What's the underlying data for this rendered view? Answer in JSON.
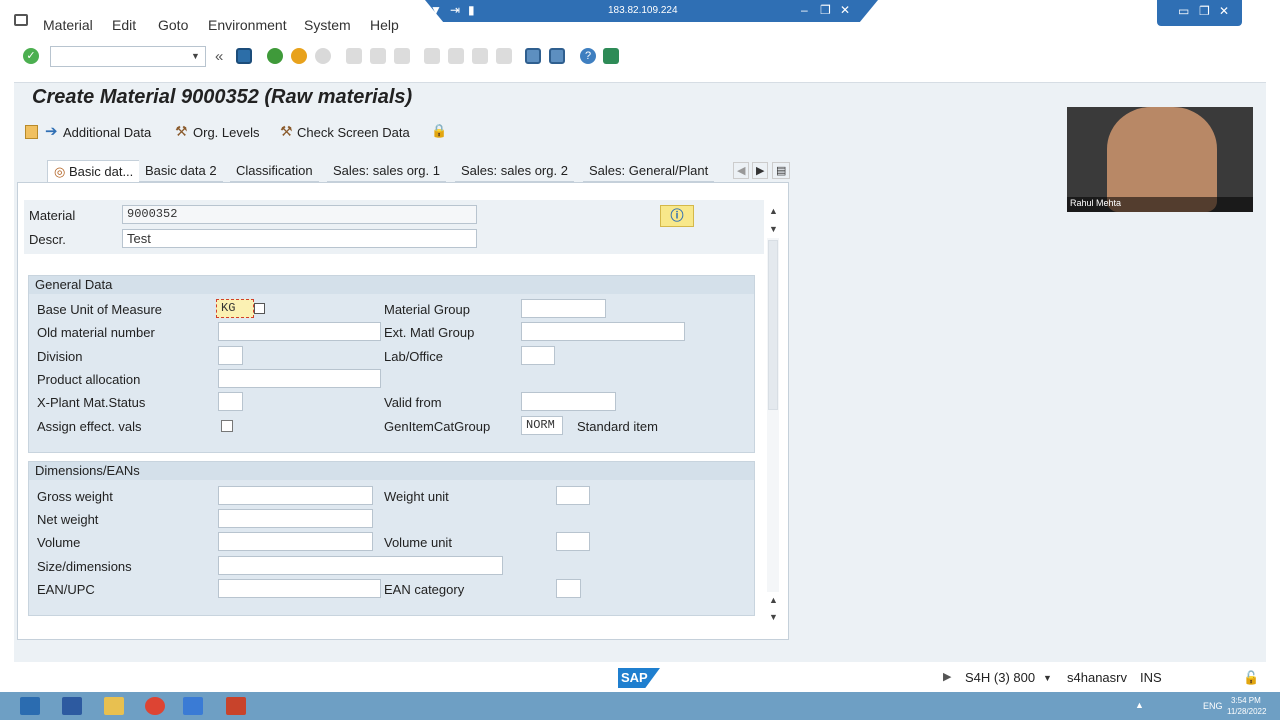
{
  "menubar": {
    "items": [
      "Material",
      "Edit",
      "Goto",
      "Environment",
      "System",
      "Help"
    ]
  },
  "titlebar": {
    "ip": "183.82.109.224"
  },
  "toolbar": {
    "command_value": ""
  },
  "page": {
    "title": "Create Material 9000352 (Raw materials)"
  },
  "app_toolbar": {
    "additional_data": "Additional Data",
    "org_levels": "Org. Levels",
    "check_screen": "Check Screen Data"
  },
  "tabs": [
    "Basic dat...",
    "Basic data 2",
    "Classification",
    "Sales: sales org. 1",
    "Sales: sales org. 2",
    "Sales: General/Plant"
  ],
  "header": {
    "material_label": "Material",
    "material_value": "9000352",
    "descr_label": "Descr.",
    "descr_value": "Test"
  },
  "general": {
    "title": "General Data",
    "base_uom_label": "Base Unit of Measure",
    "base_uom_value": "KG",
    "material_group_label": "Material Group",
    "old_material_label": "Old material number",
    "ext_matl_group_label": "Ext. Matl Group",
    "division_label": "Division",
    "lab_office_label": "Lab/Office",
    "product_alloc_label": "Product allocation",
    "xplant_label": "X-Plant Mat.Status",
    "valid_from_label": "Valid from",
    "assign_label": "Assign effect. vals",
    "genitem_label": "GenItemCatGroup",
    "genitem_value": "NORM",
    "genitem_desc": "Standard item"
  },
  "dimensions": {
    "title": "Dimensions/EANs",
    "gross_weight_label": "Gross weight",
    "weight_unit_label": "Weight unit",
    "net_weight_label": "Net weight",
    "volume_label": "Volume",
    "volume_unit_label": "Volume unit",
    "size_label": "Size/dimensions",
    "ean_label": "EAN/UPC",
    "ean_cat_label": "EAN category"
  },
  "status": {
    "logo": "SAP",
    "system": "S4H (3) 800",
    "server": "s4hanasrv",
    "mode": "INS"
  },
  "taskbar": {
    "lang": "ENG",
    "time": "3:54 PM",
    "date": "11/28/2022"
  },
  "webcam": {
    "name": "Rahul Mehta"
  }
}
